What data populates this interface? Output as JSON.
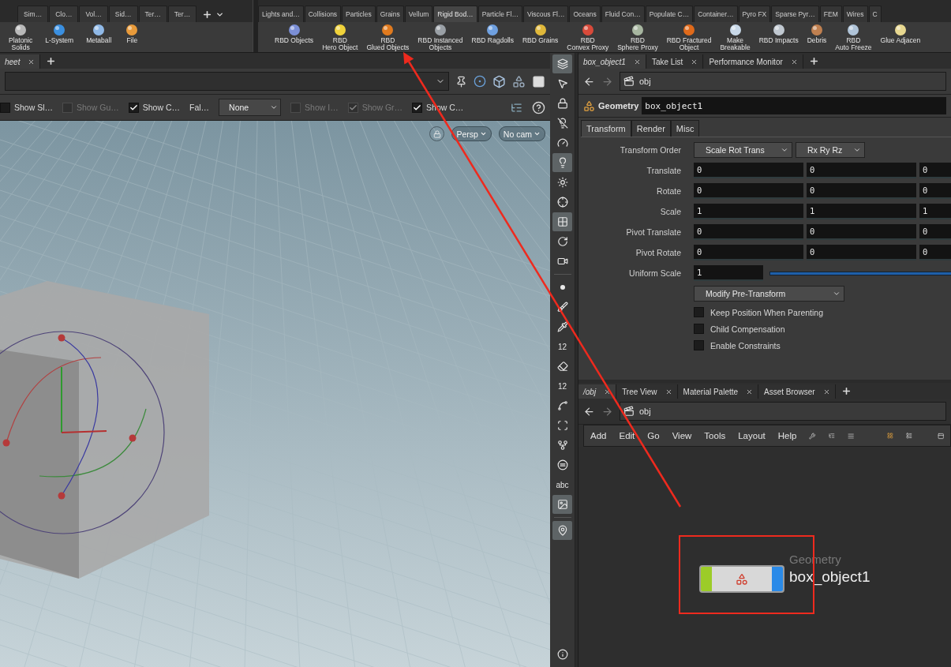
{
  "shelf_left": {
    "tabs": [
      {
        "label": "Sim…",
        "selected": false
      },
      {
        "label": "Clo…",
        "selected": false
      },
      {
        "label": "Vol…",
        "selected": false
      },
      {
        "label": "Sid…",
        "selected": false
      },
      {
        "label": "Ter…",
        "selected": false
      },
      {
        "label": "Ter…",
        "selected": false
      }
    ],
    "tools": [
      {
        "label": "Platonic\nSolids"
      },
      {
        "label": "L-System"
      },
      {
        "label": "Metaball"
      },
      {
        "label": "File"
      }
    ]
  },
  "shelf_right": {
    "tabs": [
      {
        "label": "Lights and…",
        "selected": false
      },
      {
        "label": "Collisions",
        "selected": false
      },
      {
        "label": "Particles",
        "selected": false
      },
      {
        "label": "Grains",
        "selected": false
      },
      {
        "label": "Vellum",
        "selected": false
      },
      {
        "label": "Rigid Bod…",
        "selected": true
      },
      {
        "label": "Particle Fl…",
        "selected": false
      },
      {
        "label": "Viscous Fl…",
        "selected": false
      },
      {
        "label": "Oceans",
        "selected": false
      },
      {
        "label": "Fluid Con…",
        "selected": false
      },
      {
        "label": "Populate C…",
        "selected": false
      },
      {
        "label": "Container…",
        "selected": false
      },
      {
        "label": "Pyro FX",
        "selected": false
      },
      {
        "label": "Sparse Pyr…",
        "selected": false
      },
      {
        "label": "FEM",
        "selected": false
      },
      {
        "label": "Wires",
        "selected": false
      },
      {
        "label": "C",
        "selected": false
      }
    ],
    "tools": [
      {
        "label": "RBD Objects"
      },
      {
        "label": "RBD\nHero Object"
      },
      {
        "label": "RBD\nGlued Objects"
      },
      {
        "label": "RBD Instanced\nObjects"
      },
      {
        "label": "RBD Ragdolls"
      },
      {
        "label": "RBD Grains"
      },
      {
        "label": "RBD\nConvex Proxy"
      },
      {
        "label": "RBD\nSphere Proxy"
      },
      {
        "label": "RBD Fractured\nObject"
      },
      {
        "label": "Make\nBreakable"
      },
      {
        "label": "RBD Impacts"
      },
      {
        "label": "Debris"
      },
      {
        "label": "RBD\nAuto Freeze"
      },
      {
        "label": "Glue Adjacen"
      }
    ]
  },
  "viewport": {
    "tabs": [
      {
        "label": "heet",
        "selected": true
      }
    ],
    "options": [
      {
        "kind": "checkbox",
        "label": "Show Sl…",
        "checked": false,
        "disabled": false
      },
      {
        "kind": "checkbox",
        "label": "Show Gu…",
        "checked": false,
        "disabled": true
      },
      {
        "kind": "checkbox",
        "label": "Show C…",
        "checked": true,
        "disabled": false
      },
      {
        "kind": "label",
        "label": "Fal…"
      },
      {
        "kind": "select",
        "label": "None"
      },
      {
        "kind": "checkbox",
        "label": "Show I…",
        "checked": false,
        "disabled": true
      },
      {
        "kind": "checkbox",
        "label": "Show Gr…",
        "checked": true,
        "disabled": true
      },
      {
        "kind": "checkbox",
        "label": "Show C…",
        "checked": true,
        "disabled": false
      }
    ],
    "camera_menus": [
      "Persp",
      "No cam"
    ]
  },
  "viewport_tools": [
    {
      "kind": "layers",
      "selected": true
    },
    {
      "kind": "select",
      "selected": false
    },
    {
      "kind": "lock",
      "selected": false
    },
    {
      "kind": "bulb-off",
      "selected": false
    },
    {
      "kind": "gauge",
      "selected": false
    },
    {
      "kind": "bulb",
      "selected": true
    },
    {
      "kind": "bulb-plus",
      "selected": false
    },
    {
      "kind": "bulb-target",
      "selected": false
    },
    {
      "kind": "checker",
      "selected": true
    },
    {
      "kind": "orbit",
      "selected": false
    },
    {
      "kind": "camera",
      "selected": false
    },
    {
      "kind": "point",
      "selected": false
    },
    {
      "kind": "brush",
      "selected": false
    },
    {
      "kind": "pin",
      "selected": false
    },
    {
      "kind": "number",
      "label": "12",
      "selected": false
    },
    {
      "kind": "eraser",
      "selected": false
    },
    {
      "kind": "number",
      "label": "12",
      "selected": false
    },
    {
      "kind": "curve",
      "selected": false
    },
    {
      "kind": "frame",
      "selected": false
    },
    {
      "kind": "axes",
      "selected": false
    },
    {
      "kind": "disc",
      "selected": false
    },
    {
      "kind": "text",
      "label": "abc",
      "selected": false
    },
    {
      "kind": "image",
      "selected": true
    }
  ],
  "viewport_tools_bottom": [
    {
      "kind": "location",
      "selected": true
    }
  ],
  "help_tool": {
    "kind": "info"
  },
  "parameters": {
    "tabs": [
      {
        "label": "box_object1",
        "selected": true
      },
      {
        "label": "Take List",
        "selected": false
      },
      {
        "label": "Performance Monitor",
        "selected": false
      }
    ],
    "path": "obj",
    "node_type": "Geometry",
    "node_name": "box_object1",
    "param_tabs": [
      {
        "label": "Transform",
        "selected": true
      },
      {
        "label": "Render",
        "selected": false
      },
      {
        "label": "Misc",
        "selected": false
      }
    ],
    "transform_order": {
      "label": "Transform Order",
      "menus": [
        "Scale Rot Trans",
        "Rx Ry Rz"
      ]
    },
    "vectors": [
      {
        "label": "Translate",
        "values": [
          "0",
          "0",
          "0"
        ]
      },
      {
        "label": "Rotate",
        "values": [
          "0",
          "0",
          "0"
        ]
      },
      {
        "label": "Scale",
        "values": [
          "1",
          "1",
          "1"
        ]
      },
      {
        "label": "Pivot Translate",
        "values": [
          "0",
          "0",
          "0"
        ]
      },
      {
        "label": "Pivot Rotate",
        "values": [
          "0",
          "0",
          "0"
        ]
      }
    ],
    "uniform_scale": {
      "label": "Uniform Scale",
      "value": "1"
    },
    "pre_transform": "Modify Pre-Transform",
    "toggles": [
      {
        "label": "Keep Position When Parenting",
        "checked": false
      },
      {
        "label": "Child Compensation",
        "checked": false
      },
      {
        "label": "Enable Constraints",
        "checked": false
      }
    ]
  },
  "network": {
    "tabs": [
      {
        "label": "/obj",
        "selected": true
      },
      {
        "label": "Tree View",
        "selected": false
      },
      {
        "label": "Material Palette",
        "selected": false
      },
      {
        "label": "Asset Browser",
        "selected": false
      }
    ],
    "path": "obj",
    "menu": [
      "Add",
      "Edit",
      "Go",
      "View",
      "Tools",
      "Layout",
      "Help"
    ],
    "node": {
      "type": "Geometry",
      "name": "box_object1"
    }
  }
}
